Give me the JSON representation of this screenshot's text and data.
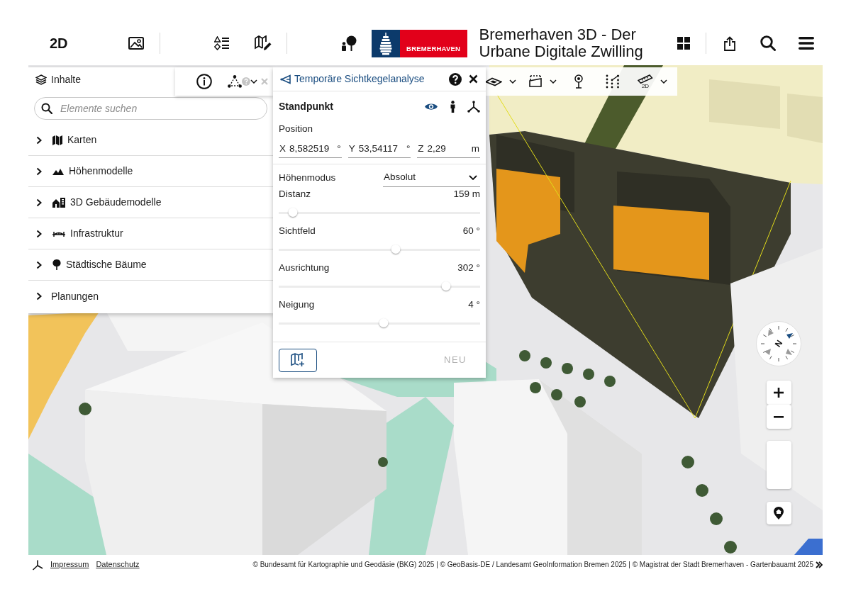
{
  "header": {
    "view_mode": "2D",
    "logo_text": "BREMERHAVEN",
    "title": "Bremerhaven 3D - Der Urbane Digitale Zwilling"
  },
  "contents_panel": {
    "title": "Inhalte",
    "search": {
      "placeholder": "Elemente suchen"
    },
    "items": [
      {
        "label": "Karten",
        "expanded": false
      },
      {
        "label": "Höhenmodelle",
        "expanded": false
      },
      {
        "label": "3D Gebäudemodelle",
        "expanded": false
      },
      {
        "label": "Infrastruktur",
        "expanded": false
      },
      {
        "label": "Städtische Bäume",
        "expanded": false
      },
      {
        "label": "Planungen",
        "expanded": false
      }
    ]
  },
  "map_toolbar": {
    "measure_badge": "2D"
  },
  "viewshed_panel": {
    "title": "Temporäre Sichtkegelanalyse",
    "section": "Standpunkt",
    "standpoint_tools": [
      {
        "selected": true
      },
      {
        "selected": false
      },
      {
        "selected": false
      }
    ],
    "position_label": "Position",
    "position": [
      {
        "axis": "X",
        "value": "8,582519",
        "unit": "°"
      },
      {
        "axis": "Y",
        "value": "53,54117",
        "unit": "°"
      },
      {
        "axis": "Z",
        "value": "2,29",
        "unit": "m"
      }
    ],
    "height_mode": {
      "label": "Höhenmodus",
      "value": "Absolut"
    },
    "sliders": [
      {
        "label": "Distanz",
        "reading": "159 m",
        "level": 0.07
      },
      {
        "label": "Sichtfeld",
        "reading": "60 °",
        "level": 0.58
      },
      {
        "label": "Ausrichtung",
        "reading": "302 °",
        "level": 0.83
      },
      {
        "label": "Neigung",
        "reading": "4 °",
        "level": 0.52
      }
    ],
    "new_button": {
      "label": "NEU",
      "disabled": true
    }
  },
  "map_controls": {
    "compass_label": "N"
  },
  "footer": {
    "links": [
      "Impressum",
      "Datenschutz"
    ],
    "attribution": "© Bundesamt für Kartographie und Geodäsie (BKG) 2025 | © GeoBasis-DE / Landesamt GeoInformation Bremen 2025 | © Magistrat der Stadt Bremerhaven - Gartenbauamt 2025"
  }
}
